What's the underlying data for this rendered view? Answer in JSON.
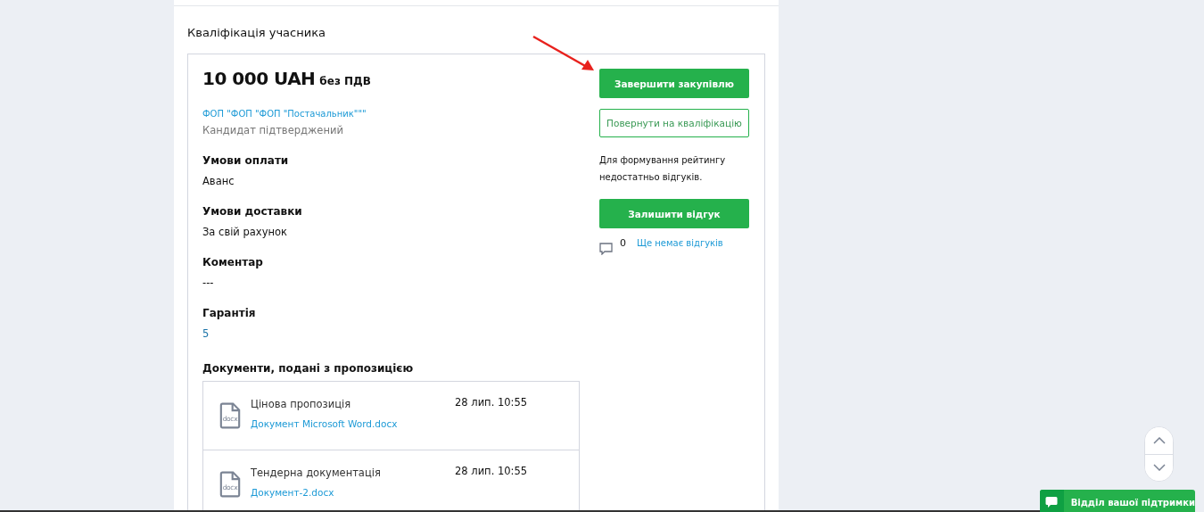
{
  "section_title": "Кваліфікація учасника",
  "price": {
    "amount": "10 000 UAH",
    "vat_note": "без ПДВ"
  },
  "supplier": {
    "name": "ФОП \"ФОП \"ФОП \"Постачальник\"\"\"",
    "status": "Кандидат підтверджений"
  },
  "fields": [
    {
      "label": "Умови оплати",
      "value": "Аванс",
      "kind": "text"
    },
    {
      "label": "Умови доставки",
      "value": "За свій рахунок",
      "kind": "text"
    },
    {
      "label": "Коментар",
      "value": "---",
      "kind": "text"
    },
    {
      "label": "Гарантія",
      "value": "5",
      "kind": "link"
    }
  ],
  "documents_title": "Документи, подані з пропозицією",
  "documents": [
    {
      "icon_label": "docx",
      "title": "Цінова пропозиція",
      "file": "Документ Microsoft Word.docx",
      "date": "28 лип. 10:55"
    },
    {
      "icon_label": "docx",
      "title": "Тендерна документація",
      "file": "Документ-2.docx",
      "date": "28 лип. 10:55"
    }
  ],
  "actions": [
    {
      "label": "Завершити закупівлю",
      "kind": "primary"
    },
    {
      "label": "Повернути на кваліфікацію",
      "kind": "outline"
    }
  ],
  "rating_note": "Для формування рейтингу недостатньо відгуків.",
  "review_button": "Залишити відгук",
  "reviews": {
    "count": "0",
    "link": "Ще немає відгуків"
  },
  "support_button": "Відділ вашої підтримки"
}
